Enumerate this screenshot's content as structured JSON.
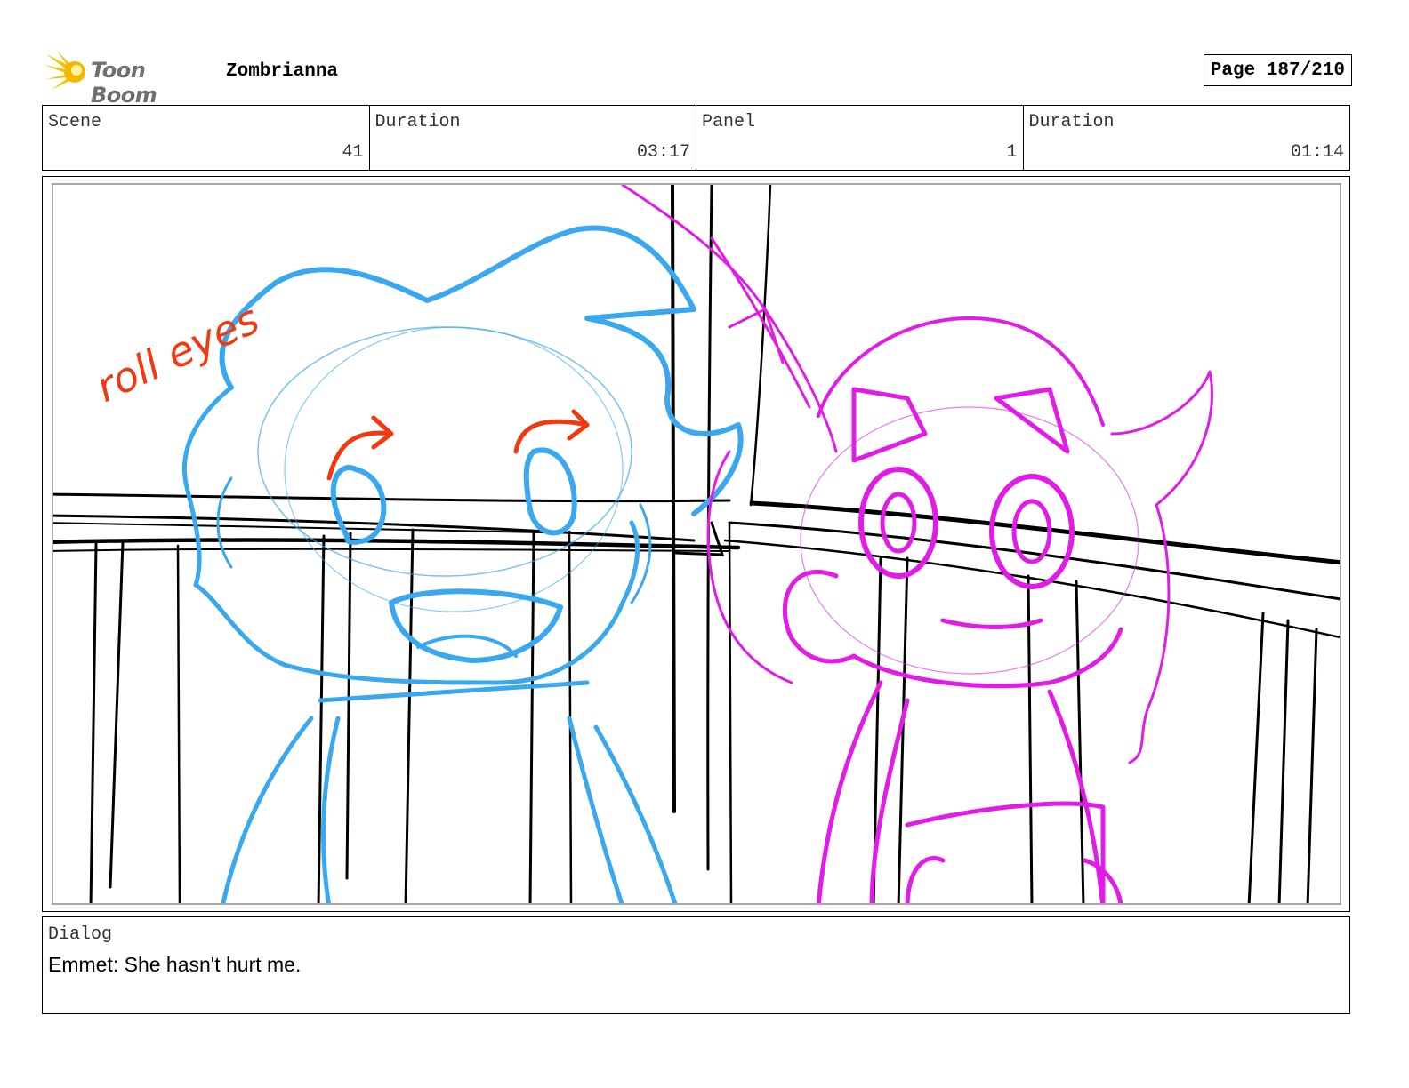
{
  "header": {
    "brand": "Toon Boom",
    "project_title": "Zombrianna",
    "page_label": "Page 187/210"
  },
  "info": {
    "scene_label": "Scene",
    "scene_value": "41",
    "scene_duration_label": "Duration",
    "scene_duration_value": "03:17",
    "panel_label": "Panel",
    "panel_value": "1",
    "panel_duration_label": "Duration",
    "panel_duration_value": "01:14"
  },
  "sketch": {
    "annotation": "roll eyes",
    "colors": {
      "left_character": "#3aa8ee",
      "right_character": "#e21ce6",
      "annotation": "#f2380f",
      "background_lines": "#000000"
    }
  },
  "dialog": {
    "label": "Dialog",
    "text": "Emmet: She hasn't hurt me."
  }
}
